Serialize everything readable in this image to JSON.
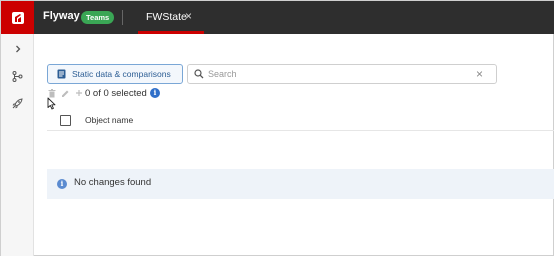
{
  "app": {
    "name": "Flyway",
    "edition_badge": "Teams",
    "brand_color": "#cc0000"
  },
  "tabs": [
    {
      "label": "FWState",
      "close_glyph": "×",
      "active": true
    }
  ],
  "rail": {
    "items": [
      {
        "icon": "chevron-right-icon"
      },
      {
        "icon": "branches-icon"
      },
      {
        "icon": "rocket-icon"
      }
    ]
  },
  "toolbar": {
    "static_data_label": "Static data & comparisons",
    "search_placeholder": "Search",
    "search_value": "",
    "clear_glyph": "×"
  },
  "selection": {
    "count_text": "0 of 0 selected",
    "info_glyph": "i"
  },
  "table": {
    "columns": [
      "Object name"
    ]
  },
  "empty_state": {
    "message": "No changes found",
    "info_glyph": "i"
  }
}
